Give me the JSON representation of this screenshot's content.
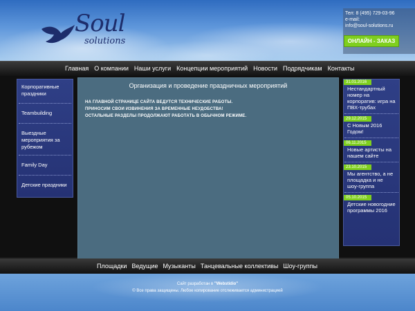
{
  "header": {
    "logo_main": "Soul",
    "logo_sub": "solutions",
    "phone": "Тел: 8 (495) 729-03-96",
    "email_label": "e-mail:",
    "email": "info@soul-solutions.ru",
    "order_button": "ОНЛАЙН - ЗАКАЗ"
  },
  "topnav": {
    "items": [
      "Главная",
      "О компании",
      "Наши услуги",
      "Концепции мероприятий",
      "Новости",
      "Подрядчикам",
      "Контакты"
    ]
  },
  "sidebar": {
    "items": [
      "Корпоративные праздники",
      "Teambuilding",
      "Выездные мероприятия за рубежом",
      "Family Day",
      "Детские праздники"
    ]
  },
  "content": {
    "title": "Организация и проведение праздничных мероприятий",
    "notice_line1": "НА ГЛАВНОЙ СТРАНИЦЕ САЙТА ВЕДУТСЯ ТЕХНИЧЕСКИЕ РАБОТЫ.",
    "notice_line2": "ПРИНОСИМ СВОИ ИЗВИНЕНИЯ ЗА ВРЕМЕННЫЕ НЕУДОБСТВА!",
    "notice_line3": "ОСТАЛЬНЫЕ РАЗДЕЛЫ ПРОДОЛЖАЮТ РАБОТАТЬ В ОБЫЧНОМ РЕЖИМЕ."
  },
  "news": {
    "items": [
      {
        "date": "31.01.2016",
        "text": "Нестандартный номер на корпоратив: игра на ПВХ-трубах"
      },
      {
        "date": "29.12.2015",
        "text": "С Новым 2016 Годом!"
      },
      {
        "date": "06.11.2015",
        "text": "Новые артисты на нашем сайте"
      },
      {
        "date": "23.10.2015",
        "text": "Мы агентство, а не площадка и не шоу-группа"
      },
      {
        "date": "05.10.2015",
        "text": "Детские новогодние программы 2016"
      }
    ]
  },
  "bottomnav": {
    "items": [
      "Площадки",
      "Ведущие",
      "Музыканты",
      "Танцевальные коллективы",
      "Шоу-группы"
    ]
  },
  "footer": {
    "dev_prefix": "Сайт разработан в",
    "dev_name": "\"Webstidio\"",
    "copyright": "© Все права защищены. Любое копирование отслеживается администрацией"
  },
  "colors": {
    "accent_green": "#7fcf1e",
    "panel_blue": "#2f3f86",
    "content_teal": "#4b6c80",
    "logo_navy": "#1d2d6b"
  }
}
